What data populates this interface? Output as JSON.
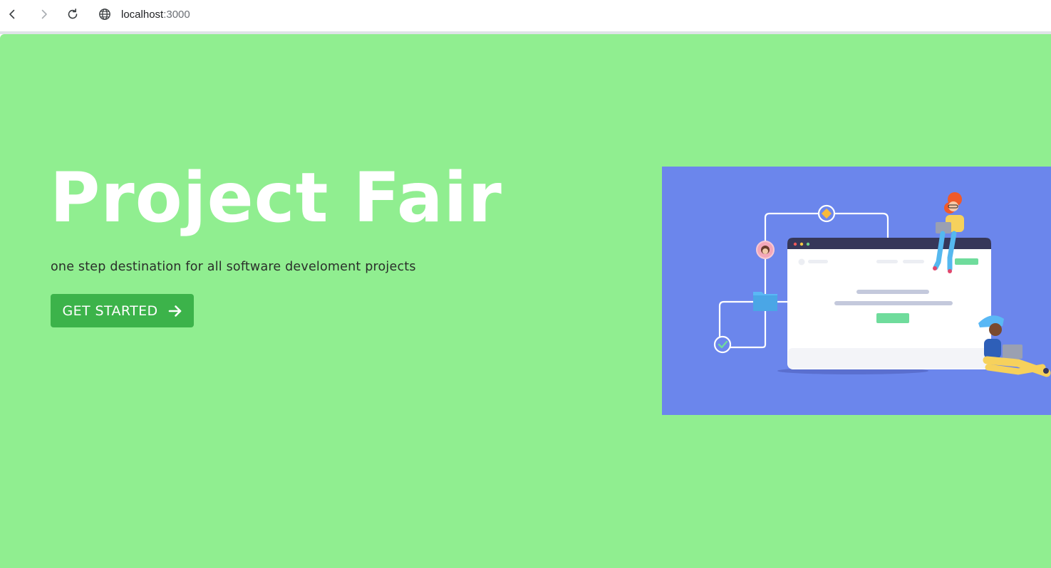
{
  "browser": {
    "url_host": "localhost",
    "url_port": ":3000",
    "icons": {
      "back": "arrow-left-icon",
      "forward": "arrow-right-icon",
      "reload": "reload-icon",
      "site": "globe-icon"
    }
  },
  "hero": {
    "title": "Project Fair",
    "subtitle": "one step destination for all software develoment projects",
    "cta_label": "GET STARTED",
    "cta_icon": "arrow-right-icon"
  },
  "colors": {
    "page_background": "#90ee90",
    "cta_background": "#3cb34a",
    "illustration_background": "#6b86ec",
    "title_color": "#ffffff"
  }
}
